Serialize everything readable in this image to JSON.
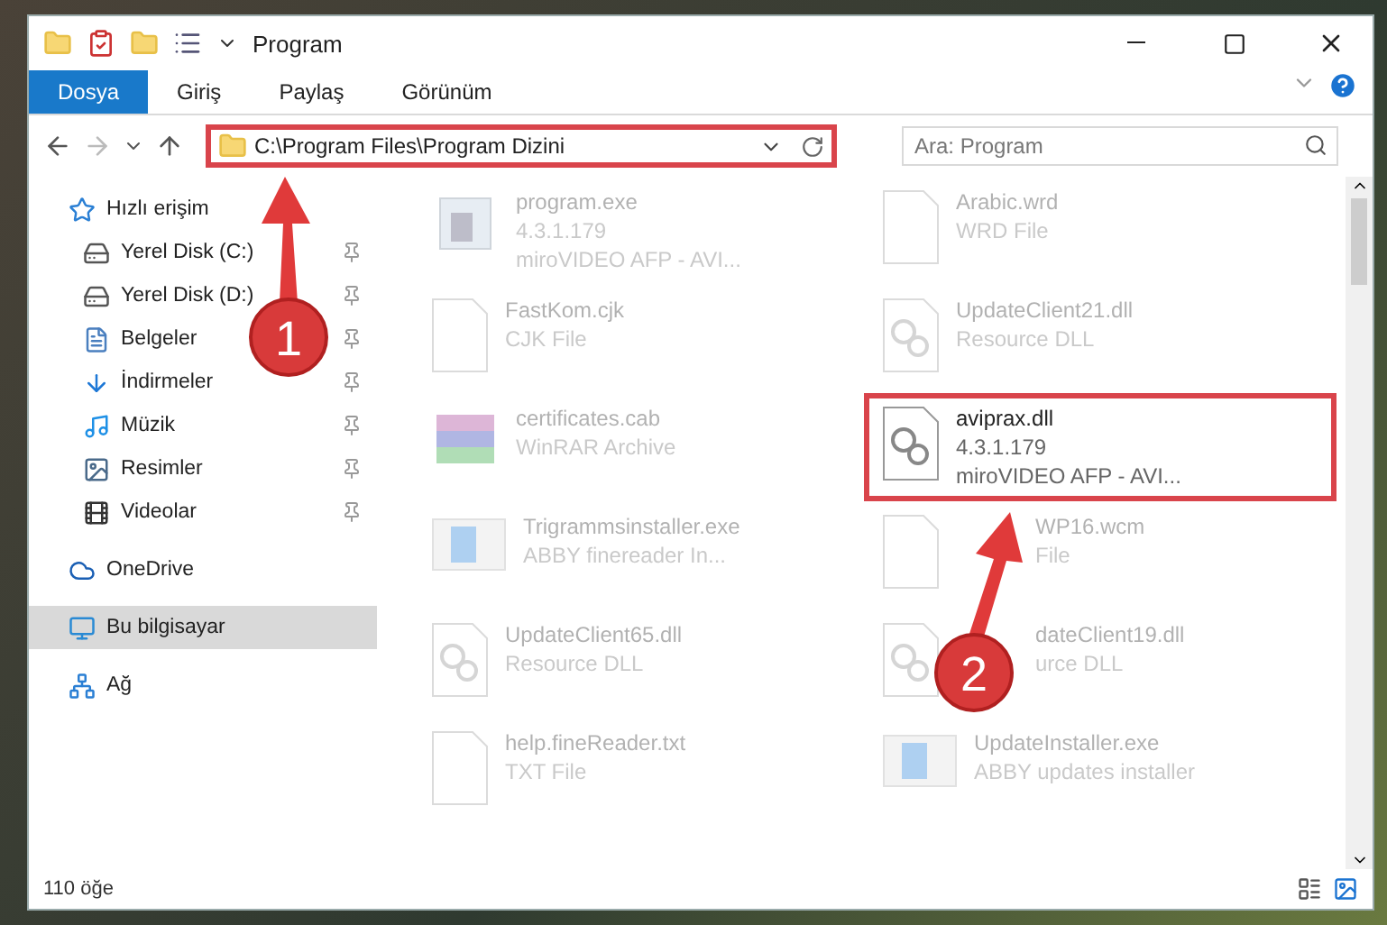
{
  "window": {
    "title": "Program"
  },
  "ribbon_tabs": [
    {
      "label": "Dosya",
      "selected": true
    },
    {
      "label": "Giriş",
      "selected": false
    },
    {
      "label": "Paylaş",
      "selected": false
    },
    {
      "label": "Görünüm",
      "selected": false
    }
  ],
  "address": {
    "path": "C:\\Program Files\\Program Dizini",
    "highlighted": true
  },
  "search": {
    "placeholder": "Ara: Program"
  },
  "sidebar": [
    {
      "label": "Hızlı erişim",
      "kind": "star",
      "selected": false,
      "children": [
        {
          "label": "Yerel Disk (C:)",
          "kind": "drive",
          "selected": false,
          "pinned": true
        },
        {
          "label": "Yerel Disk (D:)",
          "kind": "drive",
          "selected": false,
          "pinned": true
        },
        {
          "label": "Belgeler",
          "kind": "document",
          "selected": false,
          "pinned": true
        },
        {
          "label": "İndirmeler",
          "kind": "download",
          "selected": false,
          "pinned": true
        },
        {
          "label": "Müzik",
          "kind": "music",
          "selected": false,
          "pinned": true
        },
        {
          "label": "Resimler",
          "kind": "picture",
          "selected": false,
          "pinned": true
        },
        {
          "label": "Videolar",
          "kind": "video",
          "selected": false,
          "pinned": true
        }
      ]
    },
    {
      "label": "OneDrive",
      "kind": "cloud",
      "selected": false
    },
    {
      "label": "Bu bilgisayar",
      "kind": "computer",
      "selected": true
    },
    {
      "label": "Ağ",
      "kind": "network",
      "selected": false
    }
  ],
  "files": [
    {
      "name": "program.exe",
      "details": [
        "4.3.1.179",
        "miroVIDEO AFP - AVI..."
      ],
      "kind": "exe",
      "highlighted": false,
      "covered": false
    },
    {
      "name": "Arabic.wrd",
      "details": [
        "WRD File"
      ],
      "kind": "blank",
      "highlighted": false,
      "covered": false
    },
    {
      "name": "FastKom.cjk",
      "details": [
        "CJK File"
      ],
      "kind": "blank",
      "highlighted": false,
      "covered": false
    },
    {
      "name": "UpdateClient21.dll",
      "details": [
        "Resource DLL"
      ],
      "kind": "dll",
      "highlighted": false,
      "covered": false
    },
    {
      "name": "certificates.cab",
      "details": [
        "WinRAR Archive"
      ],
      "kind": "archive",
      "highlighted": false,
      "covered": false
    },
    {
      "name": "aviprax.dll",
      "details": [
        "4.3.1.179",
        "miroVIDEO AFP - AVI..."
      ],
      "kind": "dll",
      "highlighted": true,
      "covered": false
    },
    {
      "name": "Trigrammsinstaller.exe",
      "details": [
        "ABBY finereader In..."
      ],
      "kind": "installer",
      "highlighted": false,
      "covered": false
    },
    {
      "name": "WP16.wcm",
      "details": [
        "File"
      ],
      "kind": "blank",
      "highlighted": false,
      "covered": true
    },
    {
      "name": "UpdateClient65.dll",
      "details": [
        "Resource DLL"
      ],
      "kind": "dll",
      "highlighted": false,
      "covered": false
    },
    {
      "name": "dateClient19.dll",
      "details": [
        "urce DLL"
      ],
      "kind": "dll",
      "highlighted": false,
      "covered": true
    },
    {
      "name": "help.fineReader.txt",
      "details": [
        "TXT File"
      ],
      "kind": "blank",
      "highlighted": false,
      "covered": false
    },
    {
      "name": "UpdateInstaller.exe",
      "details": [
        "ABBY updates installer"
      ],
      "kind": "installer",
      "highlighted": false,
      "covered": false
    }
  ],
  "status_bar": {
    "count": "110 öğe"
  },
  "annotations": [
    {
      "number": "1"
    },
    {
      "number": "2"
    }
  ]
}
